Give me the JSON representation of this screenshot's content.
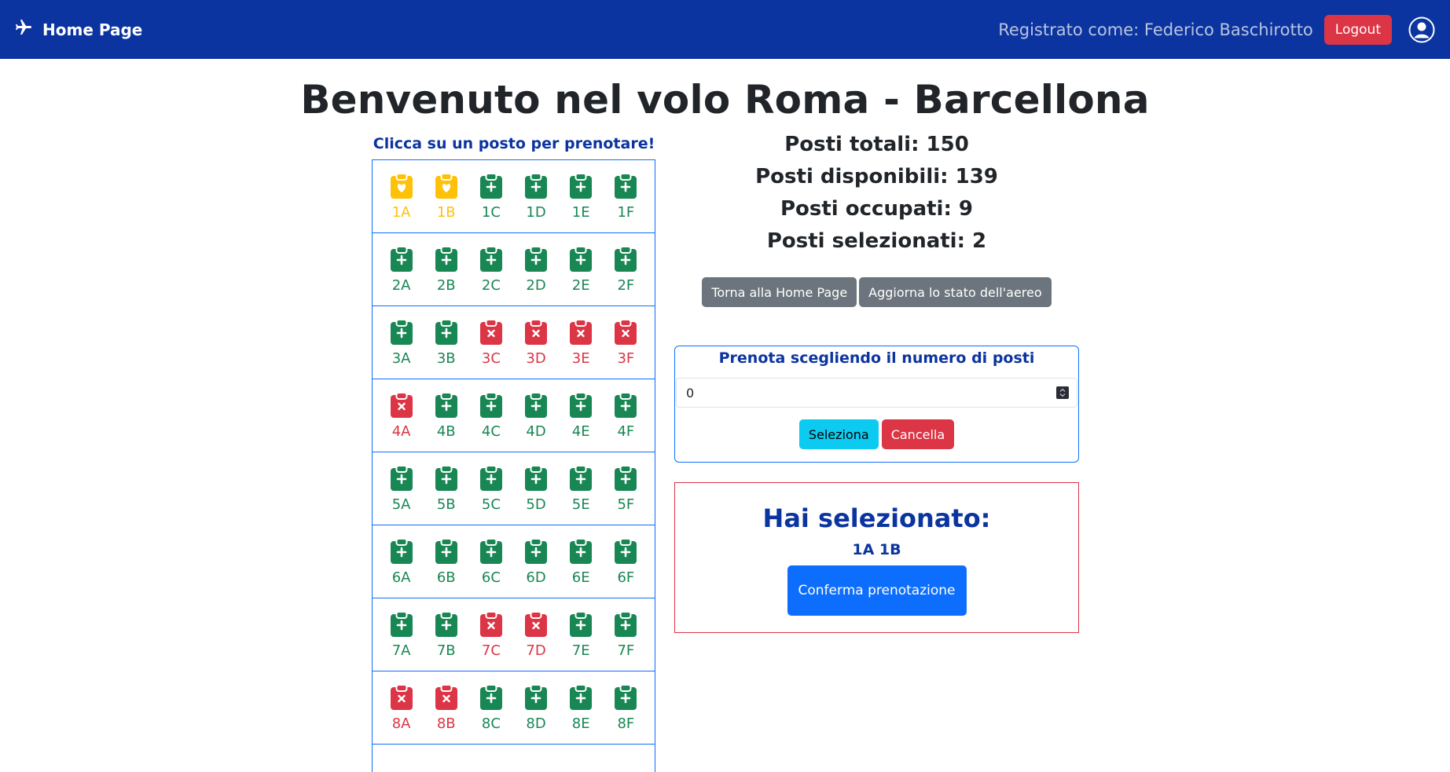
{
  "navbar": {
    "brand_label": "Home Page",
    "user_text": "Registrato come: Federico Baschirotto",
    "logout_label": "Logout"
  },
  "page_title": "Benvenuto nel volo Roma - Barcellona",
  "seat_map": {
    "hint": "Clicca su un posto per prenotare!",
    "rows": [
      [
        {
          "label": "1A",
          "status": "selected"
        },
        {
          "label": "1B",
          "status": "selected"
        },
        {
          "label": "1C",
          "status": "available"
        },
        {
          "label": "1D",
          "status": "available"
        },
        {
          "label": "1E",
          "status": "available"
        },
        {
          "label": "1F",
          "status": "available"
        }
      ],
      [
        {
          "label": "2A",
          "status": "available"
        },
        {
          "label": "2B",
          "status": "available"
        },
        {
          "label": "2C",
          "status": "available"
        },
        {
          "label": "2D",
          "status": "available"
        },
        {
          "label": "2E",
          "status": "available"
        },
        {
          "label": "2F",
          "status": "available"
        }
      ],
      [
        {
          "label": "3A",
          "status": "available"
        },
        {
          "label": "3B",
          "status": "available"
        },
        {
          "label": "3C",
          "status": "occupied"
        },
        {
          "label": "3D",
          "status": "occupied"
        },
        {
          "label": "3E",
          "status": "occupied"
        },
        {
          "label": "3F",
          "status": "occupied"
        }
      ],
      [
        {
          "label": "4A",
          "status": "occupied"
        },
        {
          "label": "4B",
          "status": "available"
        },
        {
          "label": "4C",
          "status": "available"
        },
        {
          "label": "4D",
          "status": "available"
        },
        {
          "label": "4E",
          "status": "available"
        },
        {
          "label": "4F",
          "status": "available"
        }
      ],
      [
        {
          "label": "5A",
          "status": "available"
        },
        {
          "label": "5B",
          "status": "available"
        },
        {
          "label": "5C",
          "status": "available"
        },
        {
          "label": "5D",
          "status": "available"
        },
        {
          "label": "5E",
          "status": "available"
        },
        {
          "label": "5F",
          "status": "available"
        }
      ],
      [
        {
          "label": "6A",
          "status": "available"
        },
        {
          "label": "6B",
          "status": "available"
        },
        {
          "label": "6C",
          "status": "available"
        },
        {
          "label": "6D",
          "status": "available"
        },
        {
          "label": "6E",
          "status": "available"
        },
        {
          "label": "6F",
          "status": "available"
        }
      ],
      [
        {
          "label": "7A",
          "status": "available"
        },
        {
          "label": "7B",
          "status": "available"
        },
        {
          "label": "7C",
          "status": "occupied"
        },
        {
          "label": "7D",
          "status": "occupied"
        },
        {
          "label": "7E",
          "status": "available"
        },
        {
          "label": "7F",
          "status": "available"
        }
      ],
      [
        {
          "label": "8A",
          "status": "occupied"
        },
        {
          "label": "8B",
          "status": "occupied"
        },
        {
          "label": "8C",
          "status": "available"
        },
        {
          "label": "8D",
          "status": "available"
        },
        {
          "label": "8E",
          "status": "available"
        },
        {
          "label": "8F",
          "status": "available"
        }
      ]
    ]
  },
  "stats": {
    "totali": "Posti totali: 150",
    "disponibili": "Posti disponibili: 139",
    "occupati": "Posti occupati: 9",
    "selezionati": "Posti selezionati: 2"
  },
  "actions": {
    "home_label": "Torna alla Home Page",
    "refresh_label": "Aggiorna lo stato dell'aereo"
  },
  "count_form": {
    "title": "Prenota scegliendo il numero di posti",
    "value": "0",
    "select_label": "Seleziona",
    "cancel_label": "Cancella"
  },
  "selection": {
    "title": "Hai selezionato:",
    "seats": "1A 1B",
    "confirm_label": "Conferma prenotazione"
  },
  "colors": {
    "navbar": "#0b34a0",
    "available": "#198754",
    "occupied": "#dc3545",
    "selected": "#ffc107"
  },
  "icons": {
    "brand": "airplane-icon",
    "user": "person-circle-icon",
    "seat_available": "clipboard-plus-icon",
    "seat_occupied": "clipboard-x-icon",
    "seat_selected": "clipboard-heart-icon"
  }
}
